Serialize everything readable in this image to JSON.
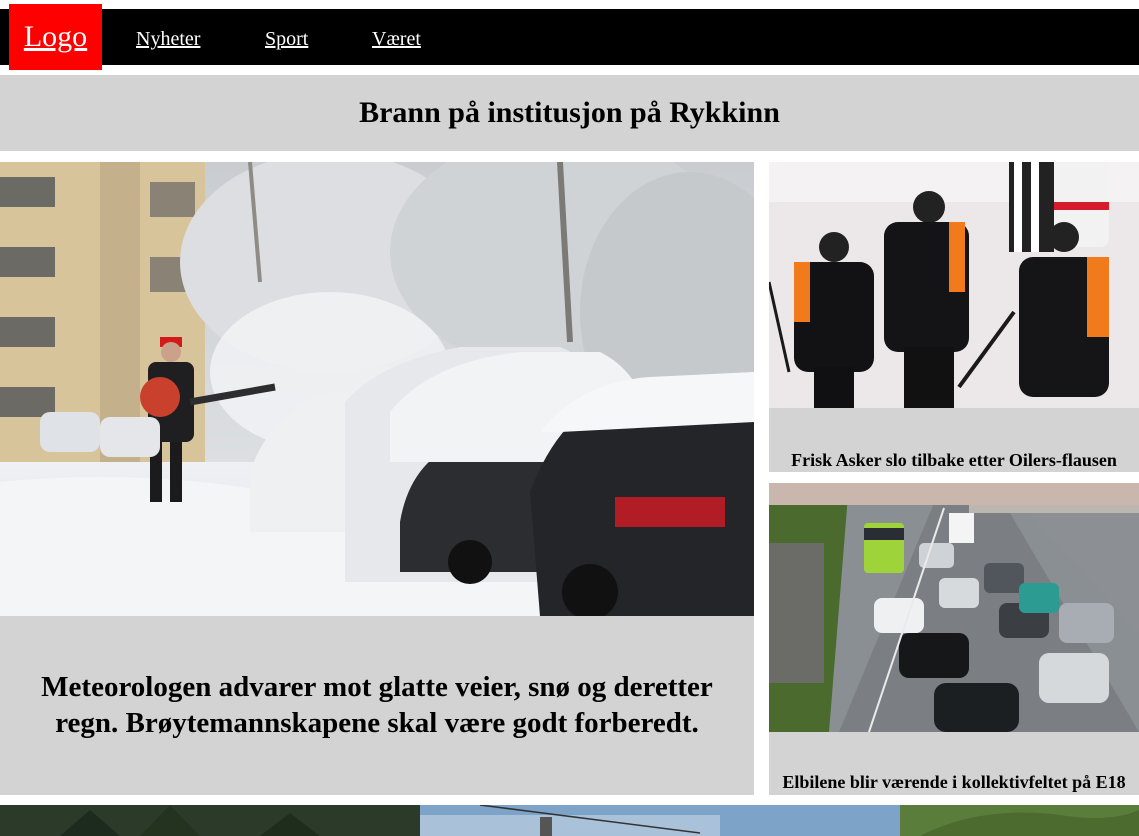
{
  "nav": {
    "logo_label": "Logo",
    "links": [
      "Nyheter",
      "Sport",
      "Været"
    ],
    "background_color": "#000000",
    "logo_color": "#ff0000"
  },
  "banner": {
    "headline": "Brann på institusjon på Rykkinn"
  },
  "main_article": {
    "caption": "Meteorologen advarer mot glatte veier, snø og deretter regn. Brøytemannskapene skal være godt forberedt."
  },
  "side_articles": [
    {
      "caption": "Frisk Asker slo tilbake etter Oilers-flausen"
    },
    {
      "caption": "Elbilene blir værende i kollektivfeltet på E18"
    }
  ],
  "colors": {
    "card_background": "#d3d3d3",
    "page_background": "#ffffff"
  }
}
